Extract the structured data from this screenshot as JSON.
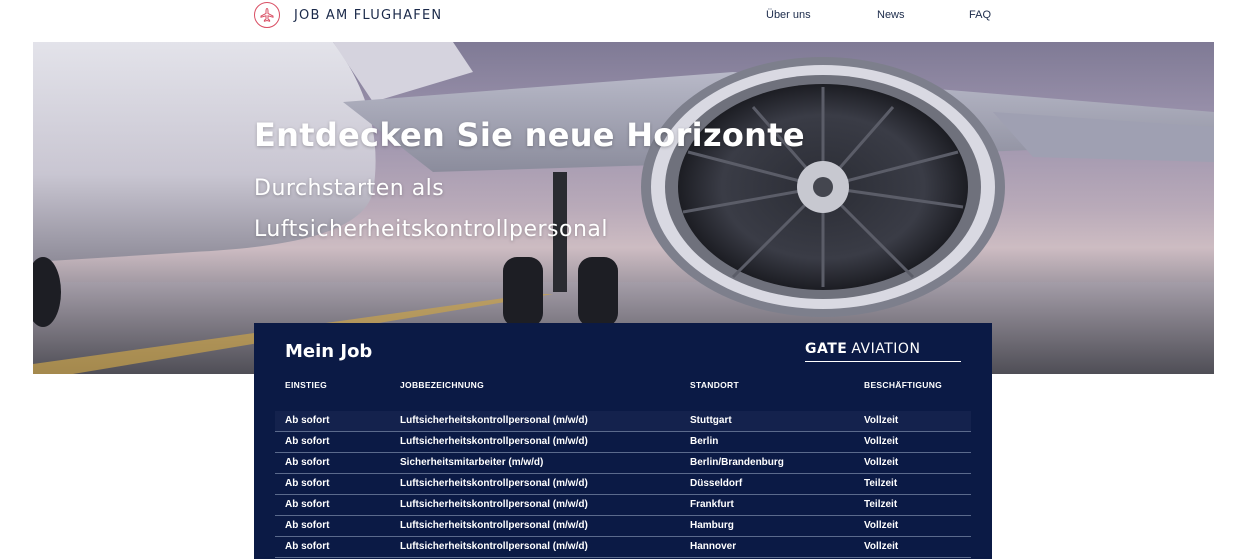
{
  "header": {
    "logo_text": "JOB AM FLUGHAFEN",
    "nav": [
      "Über uns",
      "News",
      "FAQ"
    ],
    "brand_color": "#d94e63"
  },
  "hero": {
    "title": "Entdecken Sie neue Horizonte",
    "subtitle_line1": "Durchstarten als",
    "subtitle_line2": "Luftsicherheitskontrollpersonal"
  },
  "job_panel": {
    "title": "Mein Job",
    "brand_part1": "GATE",
    "brand_part2": "AVIATION",
    "columns": [
      "EINSTIEG",
      "JOBBEZEICHNUNG",
      "STANDORT",
      "BESCHÄFTIGUNG"
    ],
    "rows": [
      [
        "Ab sofort",
        "Luftsicherheitskontrollpersonal (m/w/d)",
        "Stuttgart",
        "Vollzeit"
      ],
      [
        "Ab sofort",
        "Luftsicherheitskontrollpersonal (m/w/d)",
        "Berlin",
        "Vollzeit"
      ],
      [
        "Ab sofort",
        "Sicherheitsmitarbeiter (m/w/d)",
        "Berlin/Brandenburg",
        "Vollzeit"
      ],
      [
        "Ab sofort",
        "Luftsicherheitskontrollpersonal (m/w/d)",
        "Düsseldorf",
        "Teilzeit"
      ],
      [
        "Ab sofort",
        "Luftsicherheitskontrollpersonal (m/w/d)",
        "Frankfurt",
        "Teilzeit"
      ],
      [
        "Ab sofort",
        "Luftsicherheitskontrollpersonal (m/w/d)",
        "Hamburg",
        "Vollzeit"
      ],
      [
        "Ab sofort",
        "Luftsicherheitskontrollpersonal (m/w/d)",
        "Hannover",
        "Vollzeit"
      ]
    ],
    "background_color": "#0b1a45"
  }
}
